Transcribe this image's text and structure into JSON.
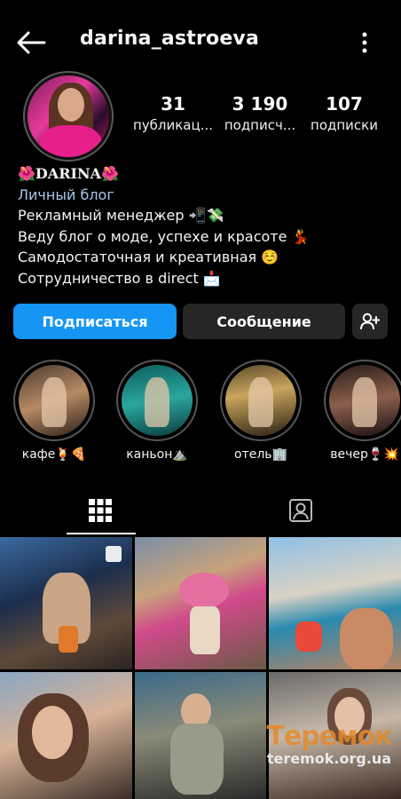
{
  "header": {
    "username": "darina_astroeva"
  },
  "stats": [
    {
      "value": "31",
      "label": "публикац..."
    },
    {
      "value": "3 190",
      "label": "подписч..."
    },
    {
      "value": "107",
      "label": "подписки"
    }
  ],
  "bio": {
    "name": "🌺DARINA🌺",
    "category": "Личный блог",
    "lines": [
      "Рекламный менеджер 📲💸",
      "Веду блог о моде, успехе и красоте 💃",
      "Самодостаточная и креативная ☺️",
      "Сотрудничество в direct 📩"
    ]
  },
  "actions": {
    "follow": "Подписаться",
    "message": "Сообщение"
  },
  "highlights": [
    {
      "label": "кафе🍹🍕"
    },
    {
      "label": "каньон⛰️"
    },
    {
      "label": "отель🏢"
    },
    {
      "label": "вечер🍷💥"
    }
  ],
  "icons": {
    "back": "arrow-left-icon",
    "more": "more-vertical-icon",
    "add_user": "add-user-icon",
    "grid": "grid-icon",
    "tagged": "tagged-icon"
  },
  "colors": {
    "accent": "#1596f4",
    "secondary_button": "#262626",
    "category_link": "#a8c7e8",
    "background": "#000000"
  },
  "watermark": {
    "logo": "Теремок",
    "url": "teremok.org.ua"
  }
}
